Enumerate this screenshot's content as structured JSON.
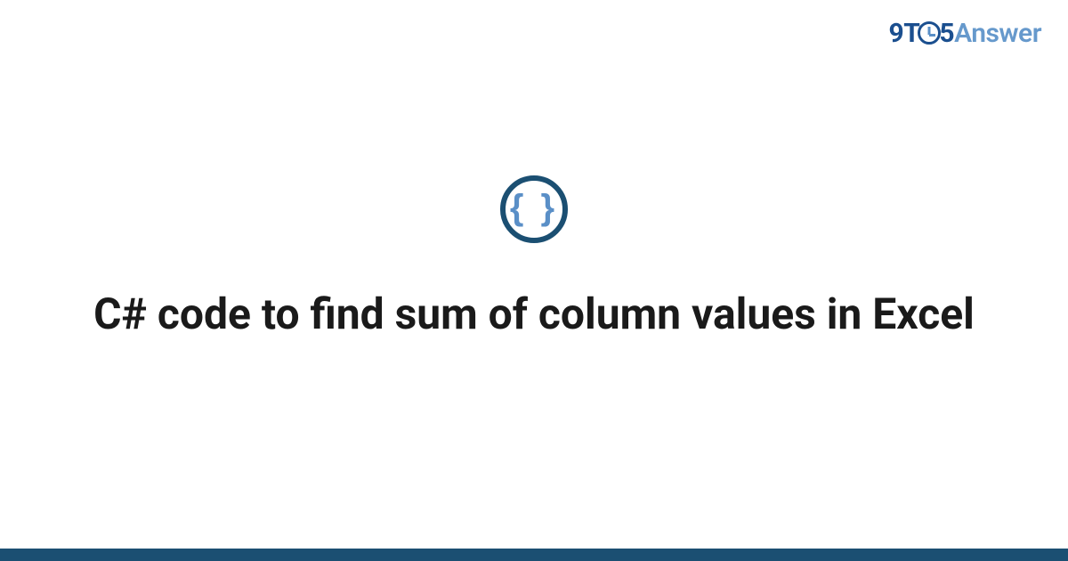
{
  "logo": {
    "part1": "9T",
    "part2": "5",
    "part3": "Answer"
  },
  "icon": {
    "braces": "{ }"
  },
  "title": "C# code to find sum of column values in Excel",
  "colors": {
    "primary_dark": "#1b4f72",
    "primary_mid": "#1b4f8f",
    "accent_light": "#6699cc",
    "brace_blue": "#5a8fc7"
  }
}
